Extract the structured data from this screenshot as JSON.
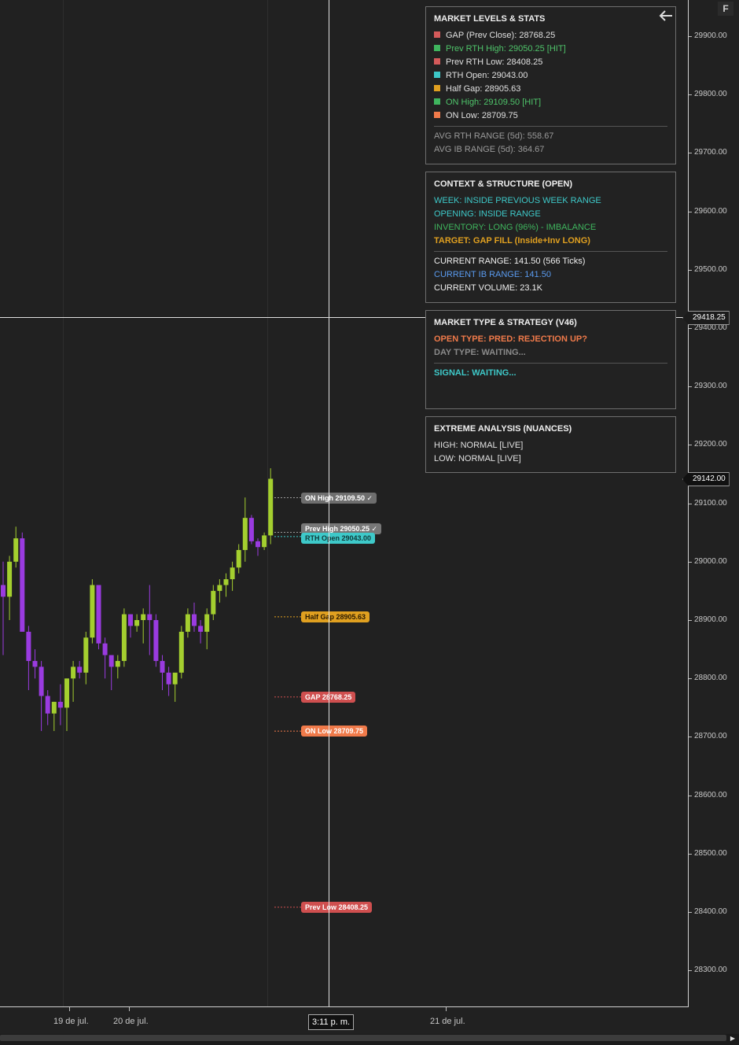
{
  "toolbar": {
    "f_button": "F"
  },
  "price_axis": {
    "labels": [
      "29900.00",
      "29800.00",
      "29700.00",
      "29600.00",
      "29500.00",
      "29400.00",
      "29300.00",
      "29200.00",
      "29100.00",
      "29000.00",
      "28900.00",
      "28800.00",
      "28700.00",
      "28600.00",
      "28500.00",
      "28400.00",
      "28300.00"
    ],
    "crosshair_price": "29418.25",
    "last_price": "29142.00"
  },
  "date_axis": {
    "labels": [
      "19 de jul.",
      "20 de jul.",
      "21 de jul."
    ],
    "crosshair_time": "3:11 p. m."
  },
  "market_levels": {
    "title": "MARKET LEVELS & STATS",
    "items": [
      {
        "text": "GAP (Prev Close): 28768.25",
        "color": "#d45a5a",
        "text_color": "#e0e0e0"
      },
      {
        "text": "Prev RTH High: 29050.25 [HIT]",
        "color": "#3fb55e",
        "text_color": "#4fc46a"
      },
      {
        "text": "Prev RTH Low: 28408.25",
        "color": "#d45a5a",
        "text_color": "#e0e0e0"
      },
      {
        "text": "RTH Open: 29043.00",
        "color": "#3dc7c7",
        "text_color": "#e0e0e0"
      },
      {
        "text": "Half Gap: 28905.63",
        "color": "#e0a020",
        "text_color": "#e0e0e0"
      },
      {
        "text": "ON High: 29109.50 [HIT]",
        "color": "#3fb55e",
        "text_color": "#4fc46a"
      },
      {
        "text": "ON Low: 28709.75",
        "color": "#f07a4a",
        "text_color": "#e0e0e0"
      }
    ],
    "avg_rth": "AVG RTH RANGE (5d): 558.67",
    "avg_ib": "AVG IB RANGE (5d): 364.67"
  },
  "context": {
    "title": "CONTEXT & STRUCTURE (OPEN)",
    "week": "WEEK: INSIDE PREVIOUS WEEK RANGE",
    "opening": "OPENING: INSIDE RANGE",
    "inventory": "INVENTORY: LONG (96%) - IMBALANCE",
    "target": "TARGET: GAP FILL (Inside+Inv LONG)",
    "current_range": "CURRENT RANGE: 141.50 (566 Ticks)",
    "ib_range": "CURRENT IB RANGE: 141.50",
    "volume": "CURRENT VOLUME: 23.1K"
  },
  "market_type": {
    "title": "MARKET TYPE & STRATEGY (V46)",
    "open_type": "OPEN TYPE: PRED: REJECTION UP?",
    "day_type": "DAY TYPE: WAITING...",
    "signal": "SIGNAL: WAITING..."
  },
  "extreme": {
    "title": "EXTREME ANALYSIS (NUANCES)",
    "high": "HIGH: NORMAL [LIVE]",
    "low": "LOW: NORMAL [LIVE]"
  },
  "level_tags": {
    "on_high": "ON High 29109.50 ✓",
    "prev_high": "Prev High 29050.25 ✓",
    "rth_open": "RTH Open 29043.00",
    "half_gap": "Half Gap 28905.63",
    "gap": "GAP 28768.25",
    "on_low": "ON Low 28709.75",
    "prev_low": "Prev Low 28408.25"
  },
  "colors": {
    "bull": "#a4cf2f",
    "bear": "#9a3be0",
    "on_high": "#7a7a7a",
    "rth_open": "#3ec9c9",
    "half_gap": "#e0a020",
    "gap": "#cf4f4f",
    "on_low": "#f07a4a",
    "prev_low": "#cf4f4f"
  },
  "candles": [
    {
      "o": 28960,
      "h": 29000,
      "l": 28840,
      "c": 28940
    },
    {
      "o": 28940,
      "h": 29010,
      "l": 28900,
      "c": 29000
    },
    {
      "o": 29000,
      "h": 29060,
      "l": 28990,
      "c": 29040
    },
    {
      "o": 29040,
      "h": 29050,
      "l": 28900,
      "c": 28880
    },
    {
      "o": 28880,
      "h": 28890,
      "l": 28780,
      "c": 28830
    },
    {
      "o": 28830,
      "h": 28850,
      "l": 28800,
      "c": 28820
    },
    {
      "o": 28820,
      "h": 28830,
      "l": 28710,
      "c": 28770
    },
    {
      "o": 28770,
      "h": 28780,
      "l": 28720,
      "c": 28740
    },
    {
      "o": 28740,
      "h": 28760,
      "l": 28710,
      "c": 28760
    },
    {
      "o": 28760,
      "h": 28790,
      "l": 28720,
      "c": 28750
    },
    {
      "o": 28750,
      "h": 28800,
      "l": 28710,
      "c": 28800
    },
    {
      "o": 28800,
      "h": 28830,
      "l": 28760,
      "c": 28820
    },
    {
      "o": 28820,
      "h": 28830,
      "l": 28800,
      "c": 28810
    },
    {
      "o": 28810,
      "h": 28880,
      "l": 28790,
      "c": 28870
    },
    {
      "o": 28870,
      "h": 28970,
      "l": 28860,
      "c": 28960
    },
    {
      "o": 28960,
      "h": 28960,
      "l": 28850,
      "c": 28860
    },
    {
      "o": 28860,
      "h": 28870,
      "l": 28800,
      "c": 28840
    },
    {
      "o": 28840,
      "h": 28840,
      "l": 28780,
      "c": 28820
    },
    {
      "o": 28820,
      "h": 28840,
      "l": 28800,
      "c": 28830
    },
    {
      "o": 28830,
      "h": 28920,
      "l": 28820,
      "c": 28910
    },
    {
      "o": 28910,
      "h": 28910,
      "l": 28870,
      "c": 28890
    },
    {
      "o": 28890,
      "h": 28910,
      "l": 28880,
      "c": 28900
    },
    {
      "o": 28900,
      "h": 28920,
      "l": 28860,
      "c": 28910
    },
    {
      "o": 28910,
      "h": 28960,
      "l": 28840,
      "c": 28900
    },
    {
      "o": 28900,
      "h": 28910,
      "l": 28820,
      "c": 28830
    },
    {
      "o": 28830,
      "h": 28840,
      "l": 28780,
      "c": 28810
    },
    {
      "o": 28810,
      "h": 28820,
      "l": 28770,
      "c": 28790
    },
    {
      "o": 28790,
      "h": 28800,
      "l": 28760,
      "c": 28810
    },
    {
      "o": 28810,
      "h": 28890,
      "l": 28800,
      "c": 28880
    },
    {
      "o": 28880,
      "h": 28920,
      "l": 28870,
      "c": 28910
    },
    {
      "o": 28910,
      "h": 28930,
      "l": 28880,
      "c": 28890
    },
    {
      "o": 28890,
      "h": 28900,
      "l": 28860,
      "c": 28880
    },
    {
      "o": 28880,
      "h": 28920,
      "l": 28850,
      "c": 28910
    },
    {
      "o": 28910,
      "h": 28960,
      "l": 28900,
      "c": 28950
    },
    {
      "o": 28950,
      "h": 28970,
      "l": 28930,
      "c": 28960
    },
    {
      "o": 28960,
      "h": 28980,
      "l": 28940,
      "c": 28970
    },
    {
      "o": 28970,
      "h": 29000,
      "l": 28950,
      "c": 28990
    },
    {
      "o": 28990,
      "h": 29030,
      "l": 28980,
      "c": 29020
    },
    {
      "o": 29020,
      "h": 29110,
      "l": 29000,
      "c": 29075
    },
    {
      "o": 29075,
      "h": 29080,
      "l": 29030,
      "c": 29035
    },
    {
      "o": 29035,
      "h": 29040,
      "l": 29010,
      "c": 29025
    },
    {
      "o": 29025,
      "h": 29050,
      "l": 29020,
      "c": 29045
    },
    {
      "o": 29045,
      "h": 29160,
      "l": 29030,
      "c": 29142
    }
  ]
}
